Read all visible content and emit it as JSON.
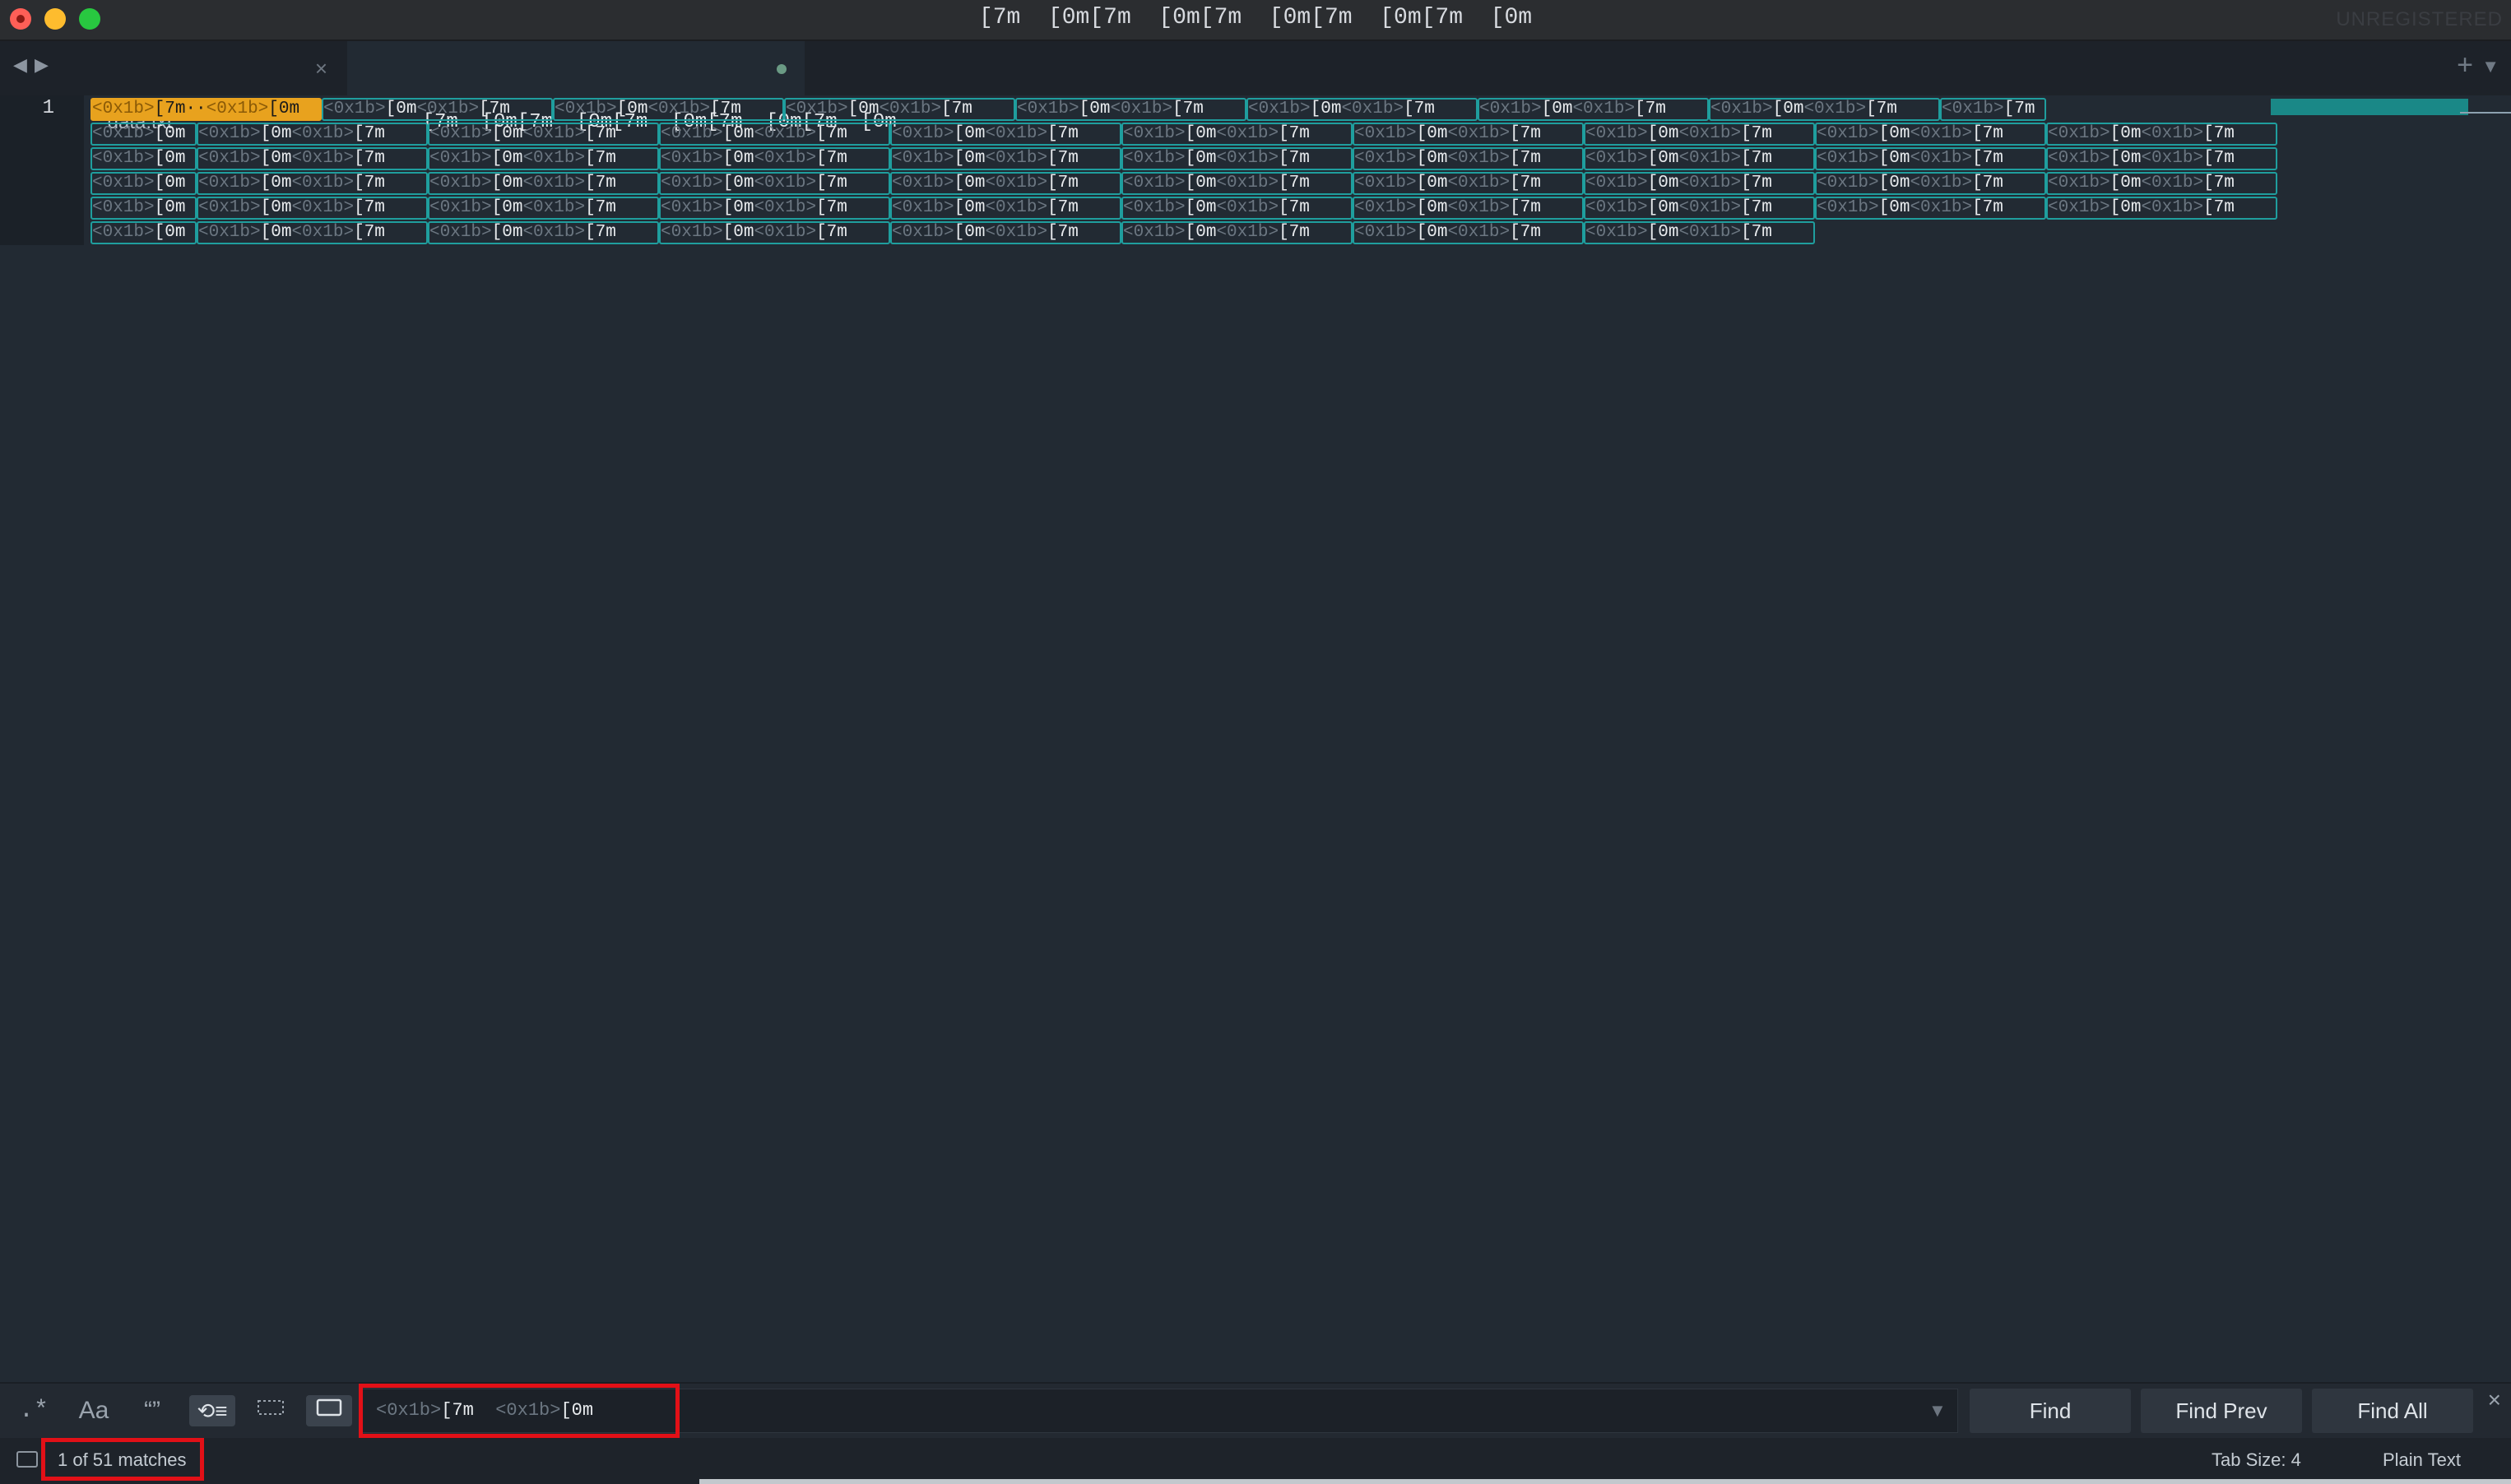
{
  "window": {
    "title": "[7m  [0m[7m  [0m[7m  [0m[7m  [0m[7m  [0m",
    "license_status": "UNREGISTERED"
  },
  "tabs": [
    {
      "label": "data.txt",
      "close": "×"
    },
    {
      "label": "[7m  [0m[7m  [0m[7m  [0m[7m  [0m[7m  [0m",
      "modified": true
    }
  ],
  "tabbar": {
    "new_tab": "+",
    "menu": "▼",
    "back": "◀",
    "forward": "▶"
  },
  "editor": {
    "line_number": "1",
    "esc": "<0x1b>",
    "open_seq": "[7m",
    "close_seq": "[0m",
    "first_match": {
      "esc": "<0x1b>",
      "seq_a": "[7m",
      "dots": "··",
      "seq_b": "[0m"
    },
    "rows": [
      {
        "type": "first",
        "full_cells": 7,
        "trailing_half": 1
      },
      {
        "type": "full",
        "cells": 9
      },
      {
        "type": "full",
        "cells": 9
      },
      {
        "type": "full",
        "cells": 9
      },
      {
        "type": "full",
        "cells": 9
      },
      {
        "type": "last",
        "cells": 7
      }
    ]
  },
  "find": {
    "regex_icon": ".*",
    "case_icon": "Aa",
    "word_icon": "“”",
    "wrap_icon": "⟲≡",
    "query": {
      "esc1": "<0x1b>",
      "seq1": "[7m",
      "esc2": "<0x1b>",
      "seq2": "[0m"
    },
    "find_label": "Find",
    "find_prev_label": "Find Prev",
    "find_all_label": "Find All",
    "close": "×",
    "dropdown": "▼"
  },
  "status": {
    "matches": "1 of 51 matches",
    "tab_size": "Tab Size: 4",
    "syntax": "Plain Text"
  },
  "colors": {
    "background": "#222a33",
    "match_border": "#1f9e9e",
    "active_match": "#e8a21e",
    "annotation_red": "#e21017"
  }
}
